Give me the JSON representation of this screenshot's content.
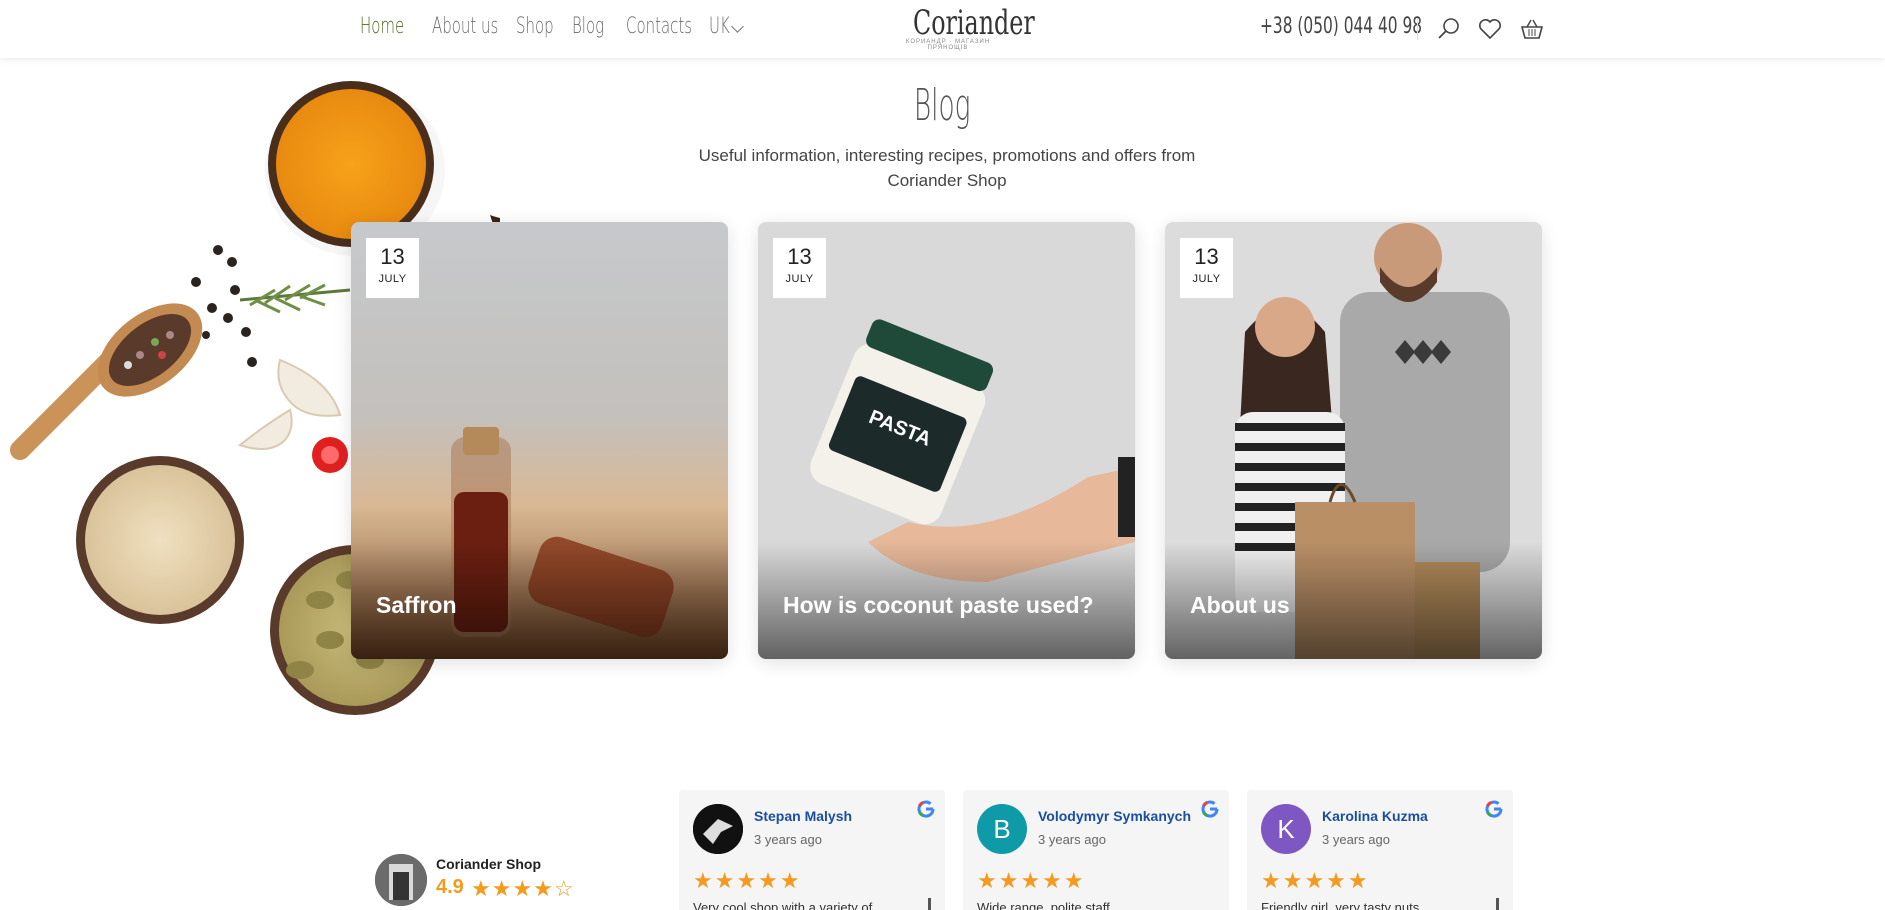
{
  "header": {
    "nav": [
      "Home",
      "About us",
      "Shop",
      "Blog",
      "Contacts",
      "UK"
    ],
    "logo": "Coriander",
    "logo_sub": "КОРИАНДР · МАГАЗИН ПРЯНОЩІВ",
    "phone": "+38 (050) 044 40 98",
    "icons": [
      "search-icon",
      "heart-icon",
      "basket-icon"
    ]
  },
  "blog": {
    "title": "Blog",
    "subtitle": "Useful information, interesting recipes, promotions and offers from Coriander Shop",
    "posts": [
      {
        "day": "13",
        "month": "JULY",
        "title": "Saffron"
      },
      {
        "day": "13",
        "month": "JULY",
        "title": "How is coconut paste used?"
      },
      {
        "day": "13",
        "month": "JULY",
        "title": "About us"
      }
    ]
  },
  "reviews": {
    "shop_name": "Coriander Shop",
    "rating": "4.9",
    "items": [
      {
        "name": "Stepan Malysh",
        "time": "3 years ago",
        "initial": "",
        "text": "Very cool shop with a variety of",
        "color": "#111111"
      },
      {
        "name": "Volodymyr Symkanych",
        "time": "3 years ago",
        "initial": "B",
        "text": "Wide range, polite staff",
        "color": "#0e9aa7"
      },
      {
        "name": "Karolina Kuzma",
        "time": "3 years ago",
        "initial": "K",
        "text": "Friendly girl, very tasty nuts",
        "color": "#7e57c2"
      }
    ]
  },
  "colors": {
    "accent": "#4d6a1f",
    "star": "#f39a1f",
    "reviewer_link": "#1a4ea1"
  }
}
